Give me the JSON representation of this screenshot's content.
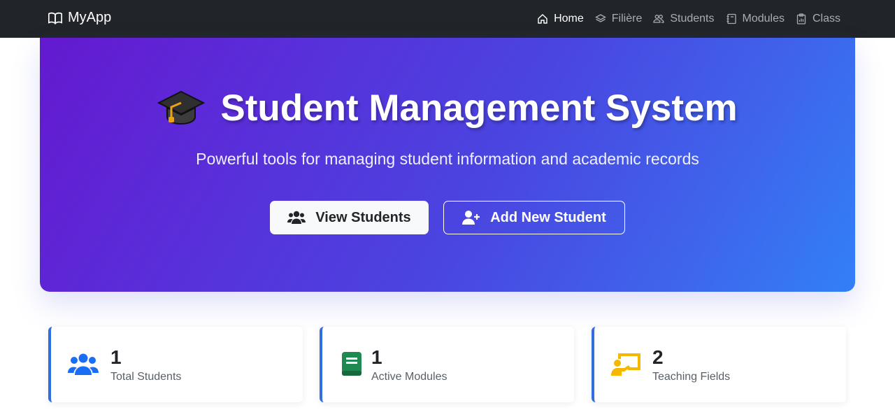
{
  "navbar": {
    "brand": "MyApp",
    "links": [
      {
        "label": "Home",
        "icon": "home-icon",
        "active": true
      },
      {
        "label": "Filière",
        "icon": "layers-icon",
        "active": false
      },
      {
        "label": "Students",
        "icon": "people-icon",
        "active": false
      },
      {
        "label": "Modules",
        "icon": "journal-icon",
        "active": false
      },
      {
        "label": "Class",
        "icon": "clipboard-icon",
        "active": false
      }
    ]
  },
  "hero": {
    "title": "Student Management System",
    "subtitle": "Powerful tools for managing student information and academic records",
    "primary_button": "View Students",
    "secondary_button": "Add New Student"
  },
  "stats": [
    {
      "value": "1",
      "label": "Total Students",
      "icon": "users-icon",
      "color": "#1a6ef5"
    },
    {
      "value": "1",
      "label": "Active Modules",
      "icon": "book-icon",
      "color": "#1e8a52"
    },
    {
      "value": "2",
      "label": "Teaching Fields",
      "icon": "chalkboard-teacher-icon",
      "color": "#f5b800"
    }
  ],
  "colors": {
    "navbar": "#212529",
    "hero_gradient_start": "#6419cf",
    "hero_gradient_end": "#3280f7",
    "card_accent": "#2f6fe0"
  }
}
